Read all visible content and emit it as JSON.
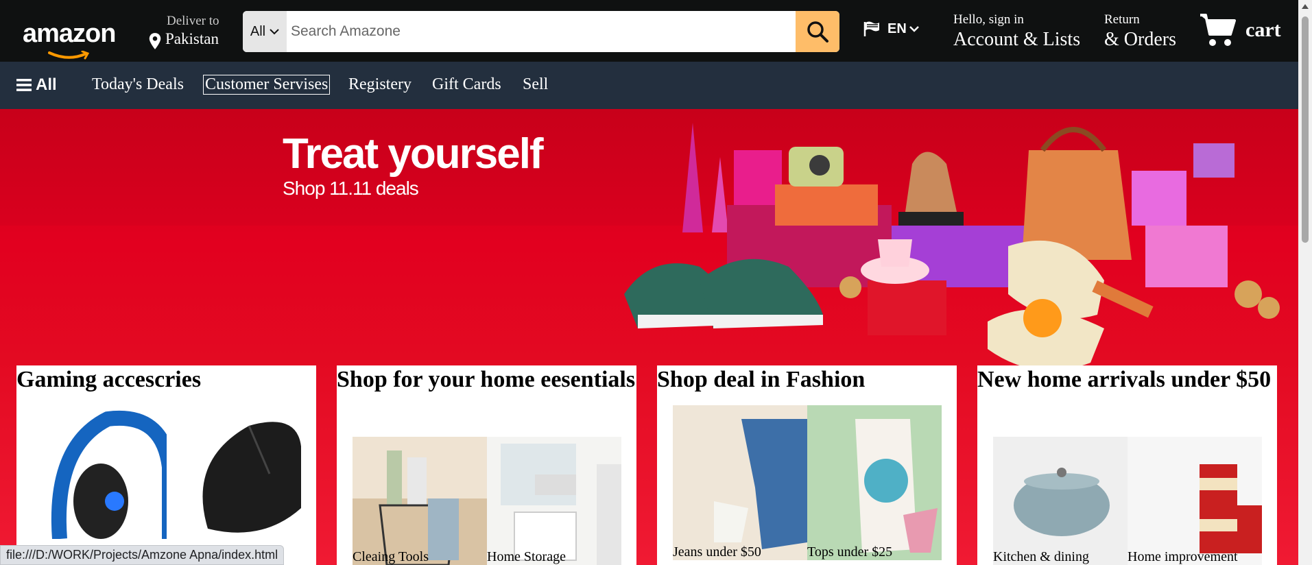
{
  "header": {
    "logo_text": "amazon",
    "deliver_small": "Deliver to",
    "deliver_location": "Pakistan",
    "search": {
      "category": "All",
      "placeholder": "Search Amazone"
    },
    "language": "EN",
    "account_small": "Hello, sign in",
    "account_big": "Account & Lists",
    "orders_small": "Return",
    "orders_big": "& Orders",
    "cart_label": "cart"
  },
  "subnav": {
    "all_label": "All",
    "items": [
      {
        "label": "Today's Deals"
      },
      {
        "label": "Customer Servises"
      },
      {
        "label": "Registery"
      },
      {
        "label": "Gift Cards"
      },
      {
        "label": "Sell"
      }
    ]
  },
  "hero": {
    "title": "Treat yourself",
    "subtitle": "Shop 11.11 deals"
  },
  "cards": [
    {
      "title": "Gaming accescries",
      "tiles": [
        {
          "caption": ""
        },
        {
          "caption": ""
        }
      ]
    },
    {
      "title": "Shop for your home eesentials",
      "tiles": [
        {
          "caption": "Cleaing Tools"
        },
        {
          "caption": "Home Storage"
        }
      ]
    },
    {
      "title": "Shop deal in Fashion",
      "tiles": [
        {
          "caption": "Jeans under $50"
        },
        {
          "caption": "Tops under $25"
        }
      ]
    },
    {
      "title": "New home arrivals under $50",
      "tiles": [
        {
          "caption": "Kitchen & dining"
        },
        {
          "caption": "Home improvement"
        }
      ]
    }
  ],
  "statusbar": {
    "url": "file:///D:/WORK/Projects/Amzone Apna/index.html"
  },
  "colors": {
    "topbar": "#0f1111",
    "subnav": "#232f3e",
    "search_button": "#febd69",
    "hero_red": "#e2001f"
  }
}
